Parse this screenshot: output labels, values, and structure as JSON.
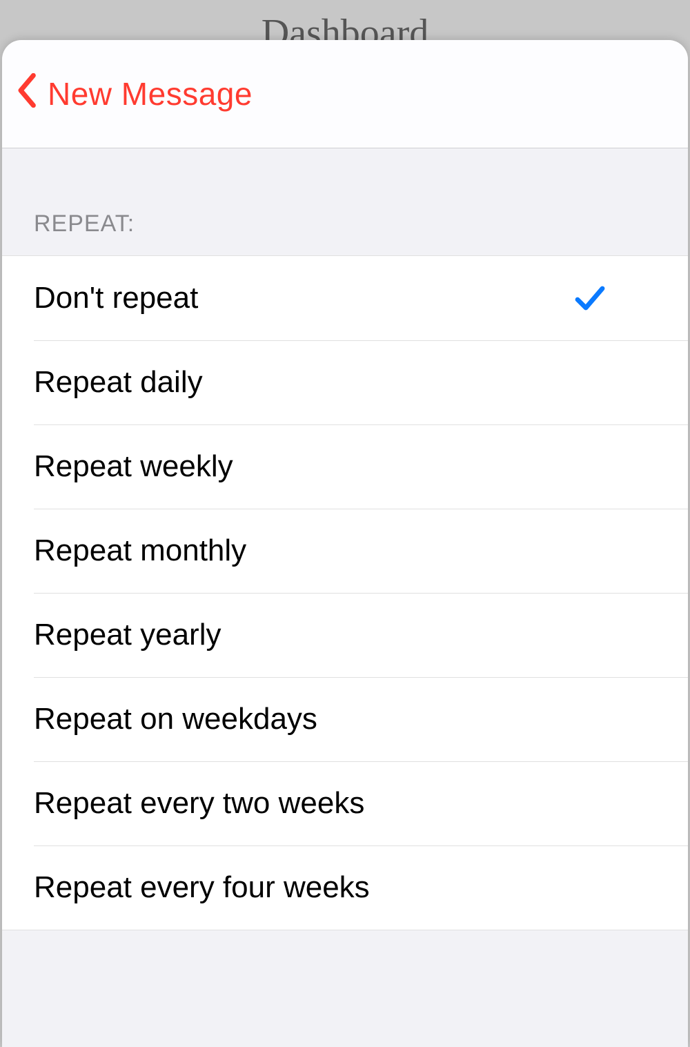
{
  "background_title": "Dashboard",
  "nav": {
    "back_label": "New Message"
  },
  "section": {
    "header": "REPEAT:"
  },
  "options": [
    {
      "label": "Don't repeat",
      "selected": true
    },
    {
      "label": "Repeat daily",
      "selected": false
    },
    {
      "label": "Repeat weekly",
      "selected": false
    },
    {
      "label": "Repeat monthly",
      "selected": false
    },
    {
      "label": "Repeat yearly",
      "selected": false
    },
    {
      "label": "Repeat on weekdays",
      "selected": false
    },
    {
      "label": "Repeat every two weeks",
      "selected": false
    },
    {
      "label": "Repeat every four weeks",
      "selected": false
    }
  ],
  "colors": {
    "accent_red": "#ff3b30",
    "accent_blue": "#0a7aff",
    "sheet_bg": "#f2f2f6"
  }
}
